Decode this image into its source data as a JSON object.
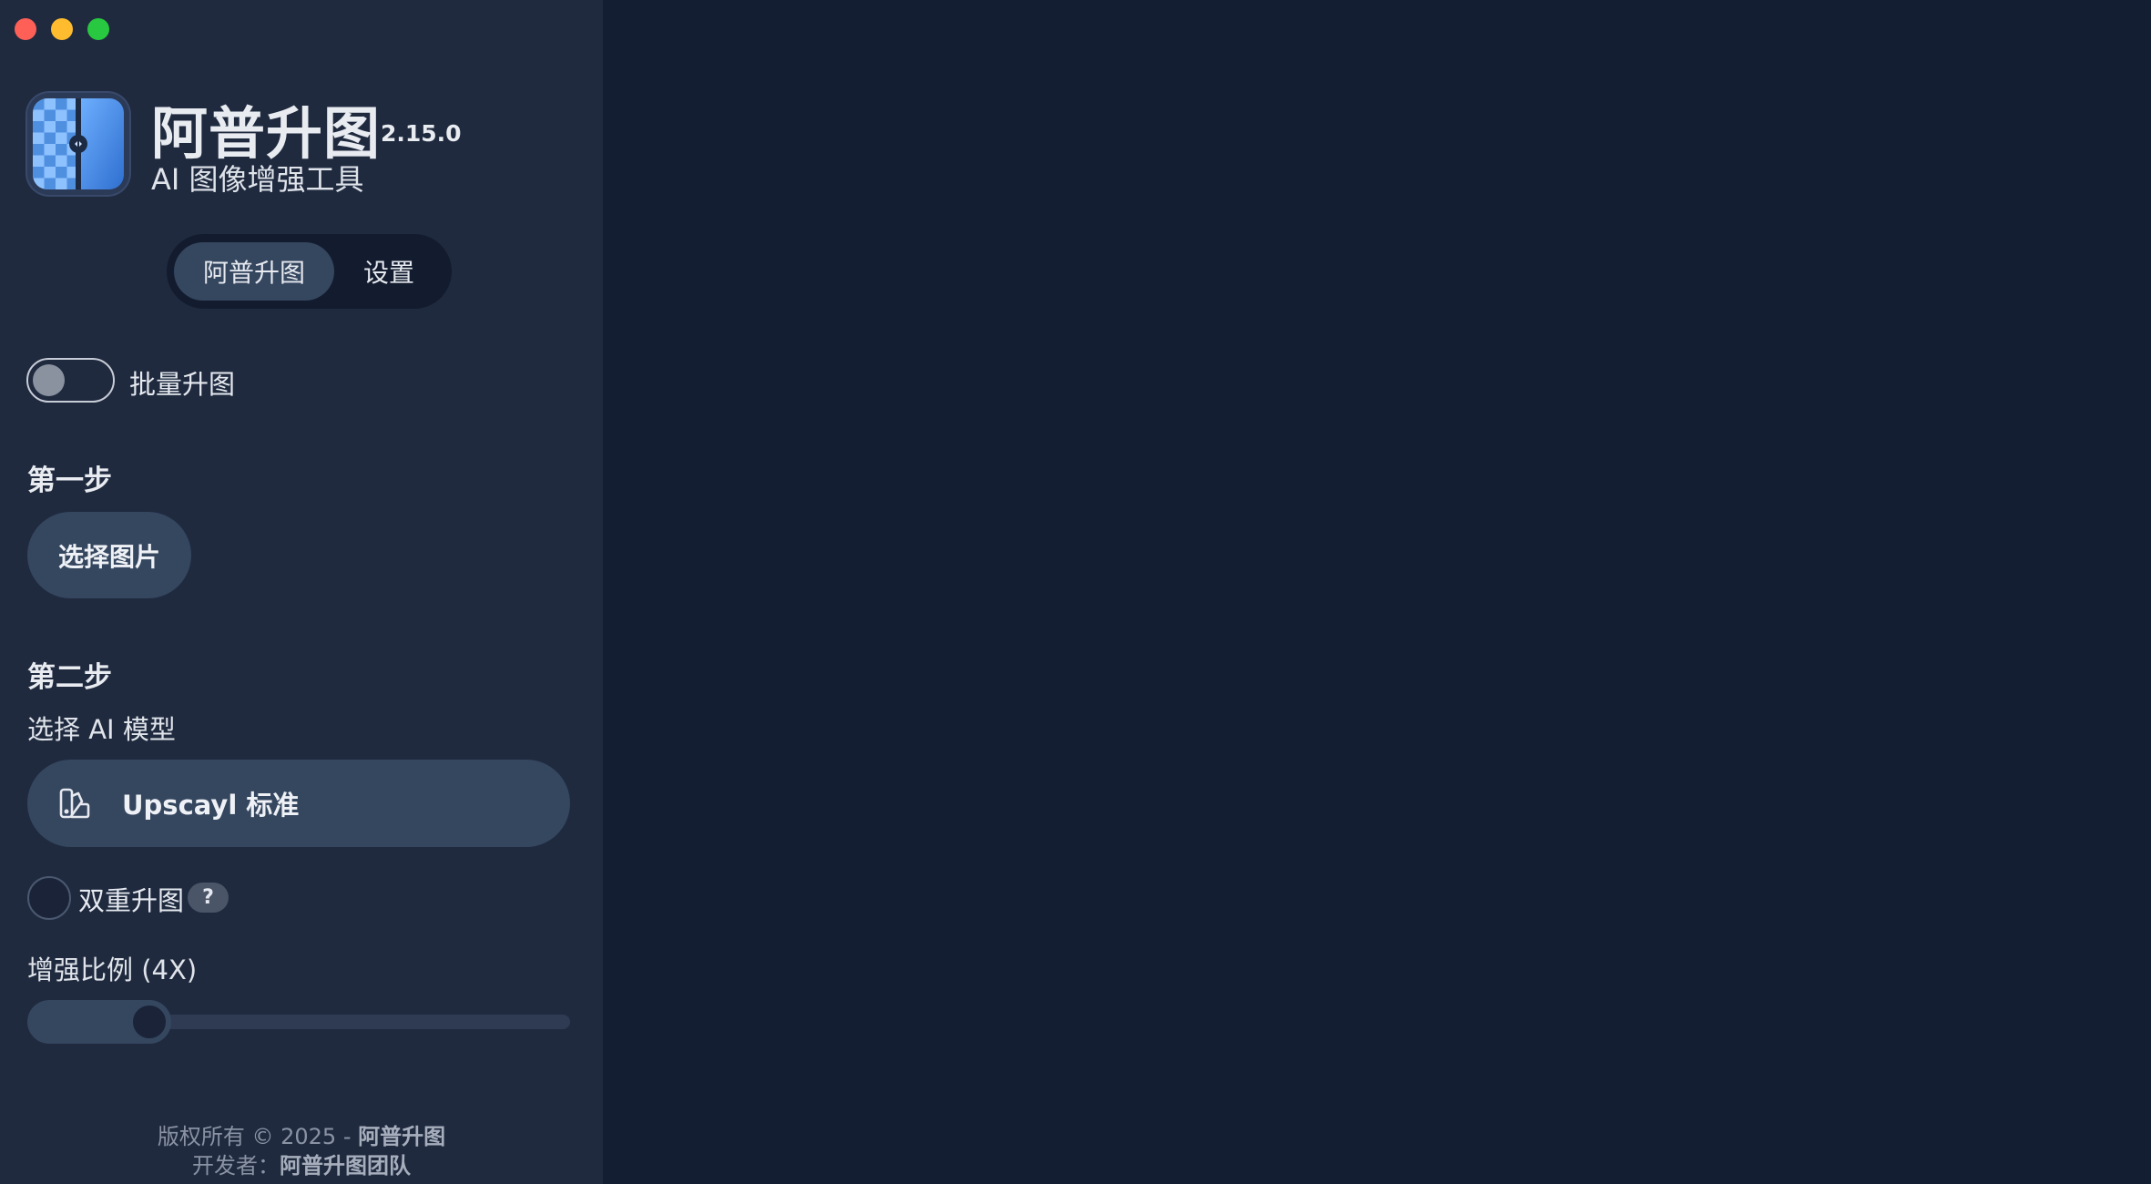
{
  "app": {
    "title": "阿普升图",
    "version": "2.15.0",
    "subtitle": "AI 图像增强工具"
  },
  "tabs": [
    {
      "label": "阿普升图",
      "active": true
    },
    {
      "label": "设置",
      "active": false
    }
  ],
  "batch": {
    "label": "批量升图",
    "enabled": false
  },
  "step1": {
    "heading": "第一步",
    "button_label": "选择图片"
  },
  "step2": {
    "heading": "第二步",
    "model_label": "选择 AI 模型",
    "model_value": "Upscayl 标准",
    "model_icon": "palette-icon",
    "double_label": "双重升图",
    "double_checked": false,
    "help_label": "?",
    "scale_label": "增强比例 (4X)",
    "scale_value": 4
  },
  "footer": {
    "copyright_prefix": "版权所有 © 2025 - ",
    "copyright_owner": "阿普升图",
    "developer_prefix": "开发者：",
    "developer_name": "阿普升图团队"
  },
  "colors": {
    "sidebar_bg": "#1f2a3f",
    "main_bg": "#141e33",
    "accent": "#35465f",
    "traffic_close": "#fe5f57",
    "traffic_min": "#febc2e",
    "traffic_max": "#28c840"
  }
}
